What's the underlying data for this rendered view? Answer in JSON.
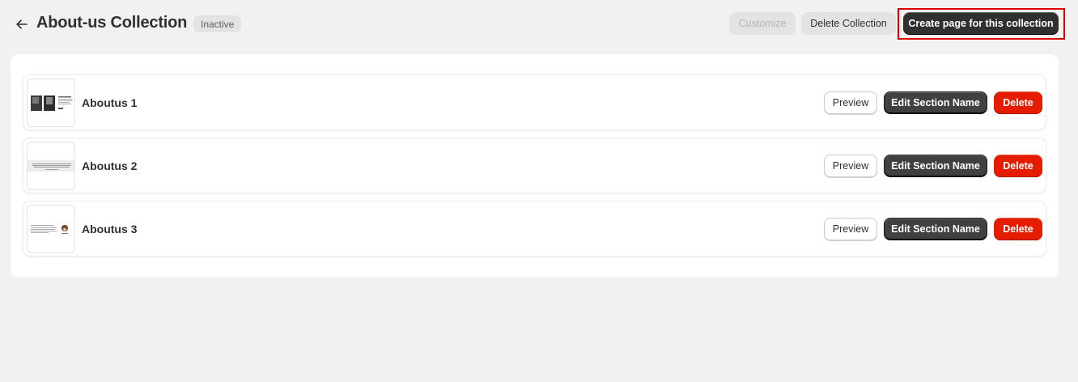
{
  "header": {
    "back_icon": "arrow-left-icon",
    "title": "About-us Collection",
    "status": "Inactive",
    "customize_label": "Customize",
    "delete_collection_label": "Delete Collection",
    "create_page_label": "Create page for this collection"
  },
  "sections": [
    {
      "title": "Aboutus 1",
      "preview_label": "Preview",
      "edit_label": "Edit Section Name",
      "delete_label": "Delete"
    },
    {
      "title": "Aboutus 2",
      "preview_label": "Preview",
      "edit_label": "Edit Section Name",
      "delete_label": "Delete"
    },
    {
      "title": "Aboutus 3",
      "preview_label": "Preview",
      "edit_label": "Edit Section Name",
      "delete_label": "Delete"
    }
  ],
  "colors": {
    "background": "#f1f1f1",
    "primary_button": "#303030",
    "danger_button": "#e51c00",
    "highlight_outline": "#e00000"
  }
}
